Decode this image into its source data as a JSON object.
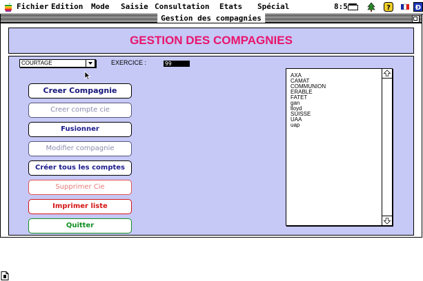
{
  "menubar": {
    "items": [
      "Fichier",
      "Edition",
      "Mode",
      "Saisie",
      "Consultation",
      "Etats",
      "Spécial"
    ],
    "clock": "8:55",
    "icons": [
      "apple-icon",
      "clock-icon",
      "tree-icon",
      "help-icon",
      "flag-icon",
      "app-icon"
    ]
  },
  "window": {
    "title": "Gestion des compagnies"
  },
  "header": {
    "title": "GESTION DES COMPAGNIES"
  },
  "controls": {
    "type_popup_value": "COURTAGE",
    "exercice_label": "EXERCICE :",
    "exercice_value": "99"
  },
  "buttons": {
    "creer_compagnie": "Creer Compagnie",
    "creer_compte": "Creer compte cie",
    "fusionner": "Fusionner",
    "modifier": "Modifier compagnie",
    "creer_tous": "Créer tous les comptes",
    "supprimer": "Supprimer Cie",
    "imprimer": "Imprimer liste",
    "quitter": "Quitter"
  },
  "companies": [
    "AXA",
    "CAMAT",
    "COMMUNION",
    "ERABLE",
    "FATET",
    "gan",
    "lloyd",
    "SUISSE",
    "UAA",
    "uap"
  ],
  "colors": {
    "panel_bg": "#c6c8f6",
    "title_pink": "#e8146c",
    "button_blue": "#1a1a8c",
    "danger_red": "#d41414",
    "quit_green": "#0d8f1f"
  }
}
